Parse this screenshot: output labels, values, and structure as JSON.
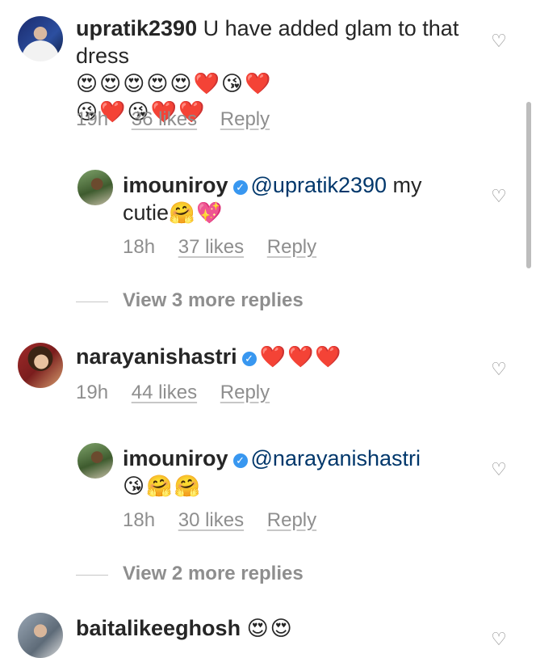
{
  "comments": [
    {
      "username": "upratik2390",
      "text": "U have added glam to that dress",
      "emoji_line1": "😍😍😍😍😍❤️😘❤️",
      "emoji_line2": "😘❤️😘❤️❤️",
      "time": "19h",
      "likes": "36 likes",
      "reply": "Reply",
      "replies": [
        {
          "username": "imouniroy",
          "mention": "@upratik2390",
          "text": "my",
          "text2": "cutie",
          "emoji": "🤗💖",
          "time": "18h",
          "likes": "37 likes",
          "reply": "Reply"
        }
      ],
      "view_more": "View 3 more replies"
    },
    {
      "username": "narayanishastri",
      "emoji": "❤️❤️❤️",
      "time": "19h",
      "likes": "44 likes",
      "reply": "Reply",
      "replies": [
        {
          "username": "imouniroy",
          "mention": "@narayanishastri",
          "emoji": "😘🤗🤗",
          "time": "18h",
          "likes": "30 likes",
          "reply": "Reply"
        }
      ],
      "view_more": "View 2 more replies"
    },
    {
      "username": "baitalikeeghosh",
      "emoji": "😍😍"
    }
  ],
  "icons": {
    "like": "heart-outline-icon",
    "verified": "verified-badge-icon"
  },
  "colors": {
    "username": "#262626",
    "mention": "#00376b",
    "meta": "#8e8e8e",
    "verified": "#3897f0"
  }
}
